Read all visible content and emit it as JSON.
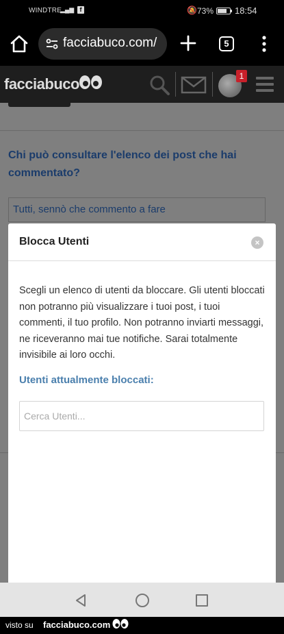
{
  "status_bar": {
    "carrier": "WINDTRE",
    "network": "4G",
    "battery_percent": "73%",
    "time": "18:54"
  },
  "browser": {
    "url": "facciabuco.com/",
    "tab_count": "5"
  },
  "site_header": {
    "logo_text": "facciabuco",
    "notification_count": "1"
  },
  "page": {
    "question": "Chi può consultare l'elenco dei post che hai commentato?",
    "selected_answer": "Tutti, sennò che commento a fare"
  },
  "modal": {
    "title": "Blocca Utenti",
    "close_glyph": "×",
    "description": "Scegli un elenco di utenti da bloccare. Gli utenti bloccati non potranno più visualizzare i tuoi post, i tuoi commenti, il tuo profilo. Non potranno inviarti messaggi, ne riceveranno mai tue notifiche. Sarai totalmente invisibile ai loro occhi.",
    "blocked_heading": "Utenti attualmente bloccati:",
    "search_placeholder": "Cerca Utenti..."
  },
  "watermark": {
    "prefix": "visto su",
    "site": "facciabuco.com"
  },
  "colors": {
    "question_text": "#1b3c6b",
    "subtitle_text": "#4a7fad",
    "badge": "#c8202a",
    "overlay": "#7f7f7f"
  }
}
